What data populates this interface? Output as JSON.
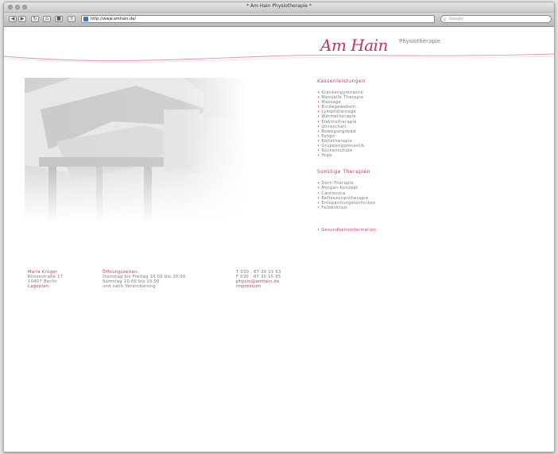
{
  "window": {
    "title": "* Am Hain Physiotherapie *"
  },
  "toolbar": {
    "back_glyph": "◀",
    "forward_glyph": "▶",
    "reload_glyph": "↻",
    "add_glyph": "+",
    "url": "http://www.amhain.de/",
    "search_placeholder": "Google"
  },
  "header": {
    "logo": "Am Hain",
    "subtitle": "Physiotherapie"
  },
  "kassenleistungen": {
    "title": "Kassenleistungen",
    "items": [
      "Krankengymnastik",
      "Manuelle Therapie",
      "Massage",
      "Bindegewebsm.",
      "Lymphdrainage",
      "Wärmetherapie",
      "Elektrotherapie",
      "Ultraschall",
      "Bewegungsbad",
      "Fango",
      "Kältetherapie",
      "Gruppengymnastik",
      "Rückenschule",
      "Yoga"
    ]
  },
  "sonstige": {
    "title": "Sonstige Therapien",
    "items": [
      "Dorn-Therapie",
      "Morgan-Konzept",
      "Cantienica",
      "Reflexzonentherapie",
      "Entspannungstechniken",
      "Feldenkrais"
    ]
  },
  "extra_link": "Gesundheitsinformation",
  "footer": {
    "name": "Maria Krüger",
    "street": "Blissestraße 17",
    "city": "10407 Berlin",
    "map_link": "Lageplan",
    "hours_title": "Öffnungszeiten:",
    "hours_1": "Dienstag bis Freitag 10.00 bis 20.00",
    "hours_2": "Samstag 10.00 bis 15.00",
    "hours_3": "und nach Vereinbarung",
    "phone": "T 030 . 67 30 15 63",
    "fax": "F 030 . 67 30 15 65",
    "email": "physio@amhain.de",
    "imprint": "Impressum"
  },
  "colors": {
    "accent": "#c8325e"
  }
}
